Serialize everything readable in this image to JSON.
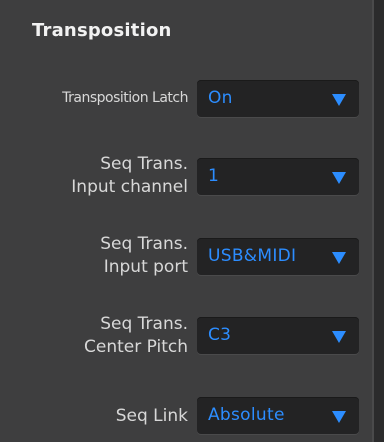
{
  "section": {
    "title": "Transposition"
  },
  "rows": [
    {
      "label_line1": "Transposition Latch",
      "label_line2": "",
      "value": "On"
    },
    {
      "label_line1": "Seq Trans.",
      "label_line2": "Input channel",
      "value": "1"
    },
    {
      "label_line1": "Seq Trans.",
      "label_line2": "Input port",
      "value": "USB&MIDI"
    },
    {
      "label_line1": "Seq Trans.",
      "label_line2": "Center Pitch",
      "value": "C3"
    },
    {
      "label_line1": "Seq Link",
      "label_line2": "",
      "value": "Absolute"
    }
  ],
  "icons": {
    "dropdown_arrow": "triangle-down-icon"
  },
  "colors": {
    "accent": "#2c8dff",
    "panel_bg": "#3e3e3f",
    "field_bg": "#232324",
    "label_text": "#d8d8d8"
  }
}
